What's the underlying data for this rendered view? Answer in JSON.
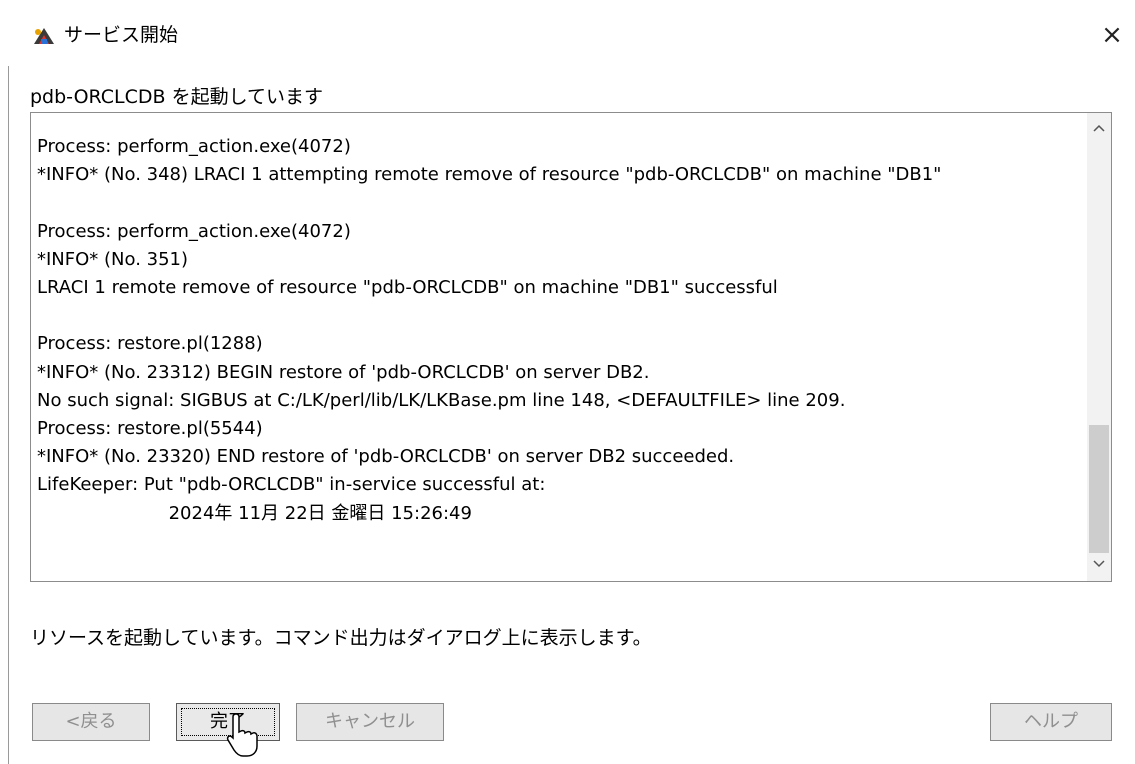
{
  "window": {
    "title": "サービス開始",
    "close_glyph": "×",
    "app_icon": "java-app-icon"
  },
  "heading": "pdb-ORCLCDB を起動しています",
  "log": {
    "lines": [
      "Process: perform_action.exe(4072)",
      "*INFO* (No. 348) LRACI 1 attempting remote remove of resource \"pdb-ORCLCDB\" on machine \"DB1\"",
      "",
      "Process: perform_action.exe(4072)",
      "*INFO* (No. 351)",
      "LRACI 1 remote remove of resource \"pdb-ORCLCDB\" on machine \"DB1\" successful",
      "",
      "Process: restore.pl(1288)",
      "*INFO* (No. 23312) BEGIN restore of 'pdb-ORCLCDB' on server DB2.",
      "No such signal: SIGBUS at C:/LK/perl/lib/LK/LKBase.pm line 148, <DEFAULTFILE> line 209.",
      "Process: restore.pl(5544)",
      "*INFO* (No. 23320) END restore of 'pdb-ORCLCDB' on server DB2 succeeded.",
      "LifeKeeper: Put \"pdb-ORCLCDB\" in-service successful at:",
      "                       2024年 11月 22日 金曜日 15:26:49"
    ],
    "scroll_up_glyph": "^",
    "scroll_down_glyph": "v"
  },
  "status": "リソースを起動しています。コマンド出力はダイアログ上に表示します。",
  "buttons": {
    "back": "<戻る",
    "finish": "完了",
    "cancel": "キャンセル",
    "help": "ヘルプ"
  },
  "colors": {
    "disabled_text": "#8f8f8f",
    "button_bg": "#e6e6e6",
    "scroll_thumb": "#cdcdcd"
  }
}
